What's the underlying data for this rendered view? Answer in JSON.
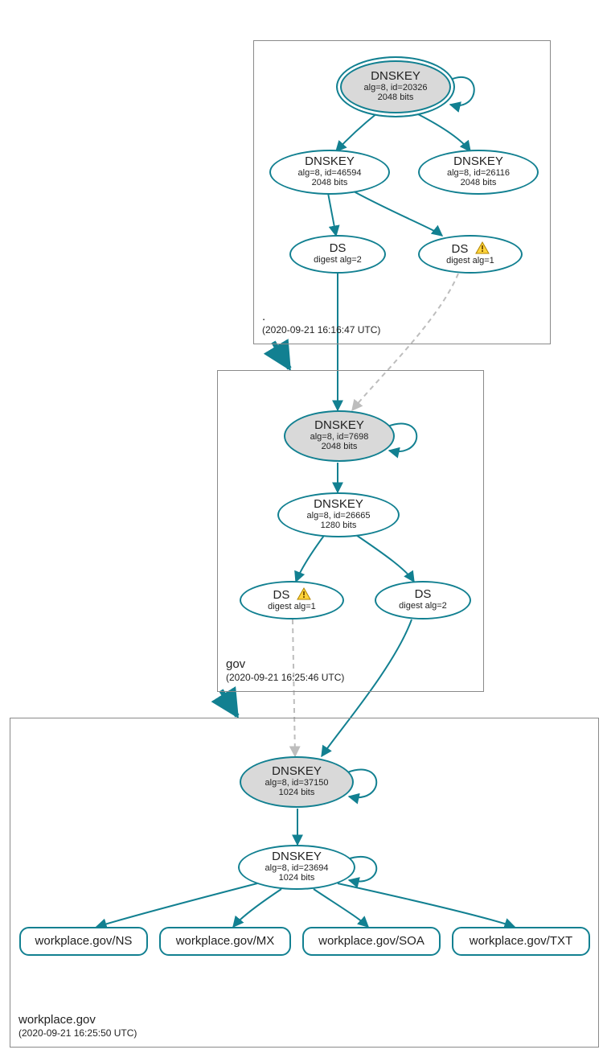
{
  "zones": {
    "root": {
      "name": ".",
      "timestamp": "(2020-09-21 16:16:47 UTC)"
    },
    "gov": {
      "name": "gov",
      "timestamp": "(2020-09-21 16:25:46 UTC)"
    },
    "workplace": {
      "name": "workplace.gov",
      "timestamp": "(2020-09-21 16:25:50 UTC)"
    }
  },
  "nodes": {
    "root_ksk": {
      "title": "DNSKEY",
      "line1": "alg=8, id=20326",
      "line2": "2048 bits"
    },
    "root_zsk1": {
      "title": "DNSKEY",
      "line1": "alg=8, id=46594",
      "line2": "2048 bits"
    },
    "root_zsk2": {
      "title": "DNSKEY",
      "line1": "alg=8, id=26116",
      "line2": "2048 bits"
    },
    "root_ds2": {
      "title": "DS",
      "line1": "digest alg=2"
    },
    "root_ds1": {
      "title": "DS",
      "line1": "digest alg=1",
      "warning": true
    },
    "gov_ksk": {
      "title": "DNSKEY",
      "line1": "alg=8, id=7698",
      "line2": "2048 bits"
    },
    "gov_zsk": {
      "title": "DNSKEY",
      "line1": "alg=8, id=26665",
      "line2": "1280 bits"
    },
    "gov_ds1": {
      "title": "DS",
      "line1": "digest alg=1",
      "warning": true
    },
    "gov_ds2": {
      "title": "DS",
      "line1": "digest alg=2"
    },
    "wp_ksk": {
      "title": "DNSKEY",
      "line1": "alg=8, id=37150",
      "line2": "1024 bits"
    },
    "wp_zsk": {
      "title": "DNSKEY",
      "line1": "alg=8, id=23694",
      "line2": "1024 bits"
    },
    "rr_ns": {
      "title": "workplace.gov/NS"
    },
    "rr_mx": {
      "title": "workplace.gov/MX"
    },
    "rr_soa": {
      "title": "workplace.gov/SOA"
    },
    "rr_txt": {
      "title": "workplace.gov/TXT"
    }
  }
}
